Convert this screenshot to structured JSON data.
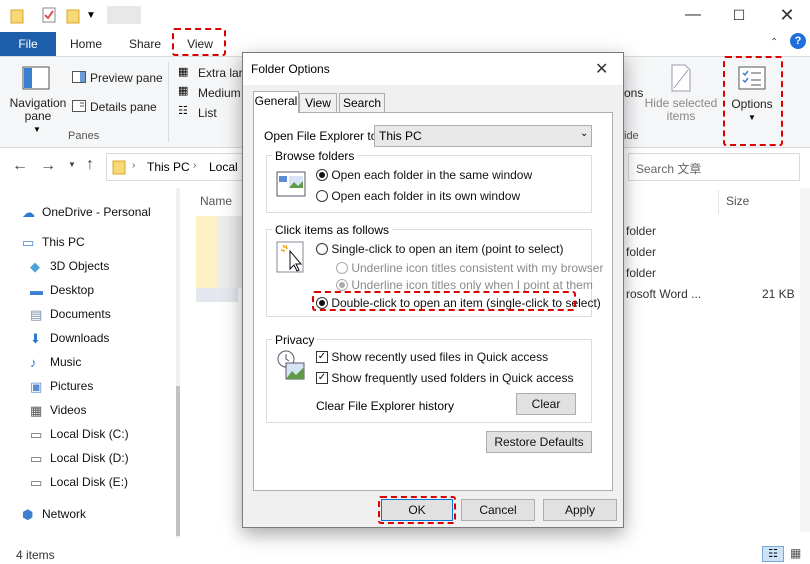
{
  "tabs": {
    "file": "File",
    "home": "Home",
    "share": "Share",
    "view": "View"
  },
  "ribbon": {
    "navigation_pane": "Navigation pane",
    "preview_pane": "Preview pane",
    "details_pane": "Details pane",
    "panes_group": "Panes",
    "extra_large": "Extra larg",
    "medium": "Medium",
    "list": "List",
    "partial_options": "ons",
    "hide_selected": "Hide selected items",
    "options": "Options",
    "partial_hide": "ide"
  },
  "address": {
    "this_pc": "This PC",
    "local": "Local D",
    "search_placeholder": "Search 文章"
  },
  "sidebar": {
    "items": [
      {
        "label": "OneDrive - Personal",
        "icon": "cloud-icon"
      },
      {
        "label": "This PC",
        "icon": "computer-icon"
      },
      {
        "label": "3D Objects",
        "icon": "cube-icon"
      },
      {
        "label": "Desktop",
        "icon": "desktop-icon"
      },
      {
        "label": "Documents",
        "icon": "document-icon"
      },
      {
        "label": "Downloads",
        "icon": "download-icon"
      },
      {
        "label": "Music",
        "icon": "music-icon"
      },
      {
        "label": "Pictures",
        "icon": "picture-icon"
      },
      {
        "label": "Videos",
        "icon": "video-icon"
      },
      {
        "label": "Local Disk (C:)",
        "icon": "disk-icon"
      },
      {
        "label": "Local Disk (D:)",
        "icon": "disk-icon"
      },
      {
        "label": "Local Disk (E:)",
        "icon": "disk-icon"
      },
      {
        "label": "Network",
        "icon": "network-icon"
      }
    ]
  },
  "filelist": {
    "col_name": "Name",
    "col_size": "Size",
    "types": [
      "folder",
      "folder",
      "folder",
      "rosoft Word ..."
    ],
    "size_last": "21 KB"
  },
  "status": {
    "items": "4 items"
  },
  "dialog": {
    "title": "Folder Options",
    "tabs": [
      "General",
      "View",
      "Search"
    ],
    "open_label": "Open File Explorer to:",
    "open_value": "This PC",
    "browse_title": "Browse folders",
    "browse_same": "Open each folder in the same window",
    "browse_own": "Open each folder in its own window",
    "click_title": "Click items as follows",
    "single_click": "Single-click to open an item (point to select)",
    "underline_browser": "Underline icon titles consistent with my browser",
    "underline_point": "Underline icon titles only when I point at them",
    "double_click": "Double-click to open an item (single-click to select)",
    "privacy_title": "Privacy",
    "show_recent": "Show recently used files in Quick access",
    "show_frequent": "Show frequently used folders in Quick access",
    "clear_history": "Clear File Explorer history",
    "clear_btn": "Clear",
    "restore_btn": "Restore Defaults",
    "ok": "OK",
    "cancel": "Cancel",
    "apply": "Apply"
  },
  "colors": {
    "accent": "#1e5fab",
    "highlight": "#dd0000"
  }
}
